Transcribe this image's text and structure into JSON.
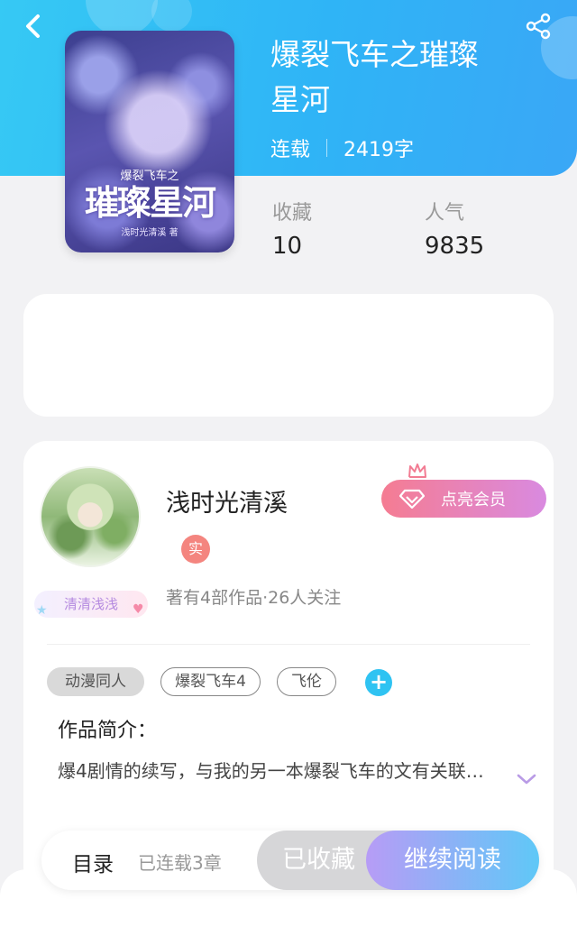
{
  "header": {
    "back_icon": "chevron-left-icon",
    "share_icon": "share-icon",
    "accent_start": "#36c9f4",
    "accent_end": "#3aa7f6"
  },
  "book": {
    "cover": {
      "subtitle": "爆裂飞车之",
      "main_title": "璀璨星河",
      "author": "浅时光清溪 著"
    },
    "title_line1": "爆裂飞车之璀璨",
    "title_line2": "星河",
    "status": "连载",
    "word_count": "2419字",
    "stats": {
      "favorites_label": "收藏",
      "favorites_value": "10",
      "popularity_label": "人气",
      "popularity_value": "9835"
    }
  },
  "author": {
    "name": "浅时光清溪",
    "nameplate": "清清浅浅",
    "real_badge": "实",
    "summary": "著有4部作品·26人关注",
    "vip_button": "点亮会员",
    "vip_icon": "diamond-icon",
    "crown_icon": "crown-icon"
  },
  "tags": [
    "动漫同人",
    "爆裂飞车4",
    "飞伦"
  ],
  "add_tag_icon": "+",
  "intro": {
    "heading": "作品简介：",
    "text": "爆4剧情的续写，与我的另一本爆裂飞车的文有关联…",
    "expand_icon": "chevron-down-icon"
  },
  "bottom_bar": {
    "toc_label": "目录",
    "toc_count": "已连载3章",
    "collected_label": "已收藏",
    "read_label": "继续阅读"
  }
}
